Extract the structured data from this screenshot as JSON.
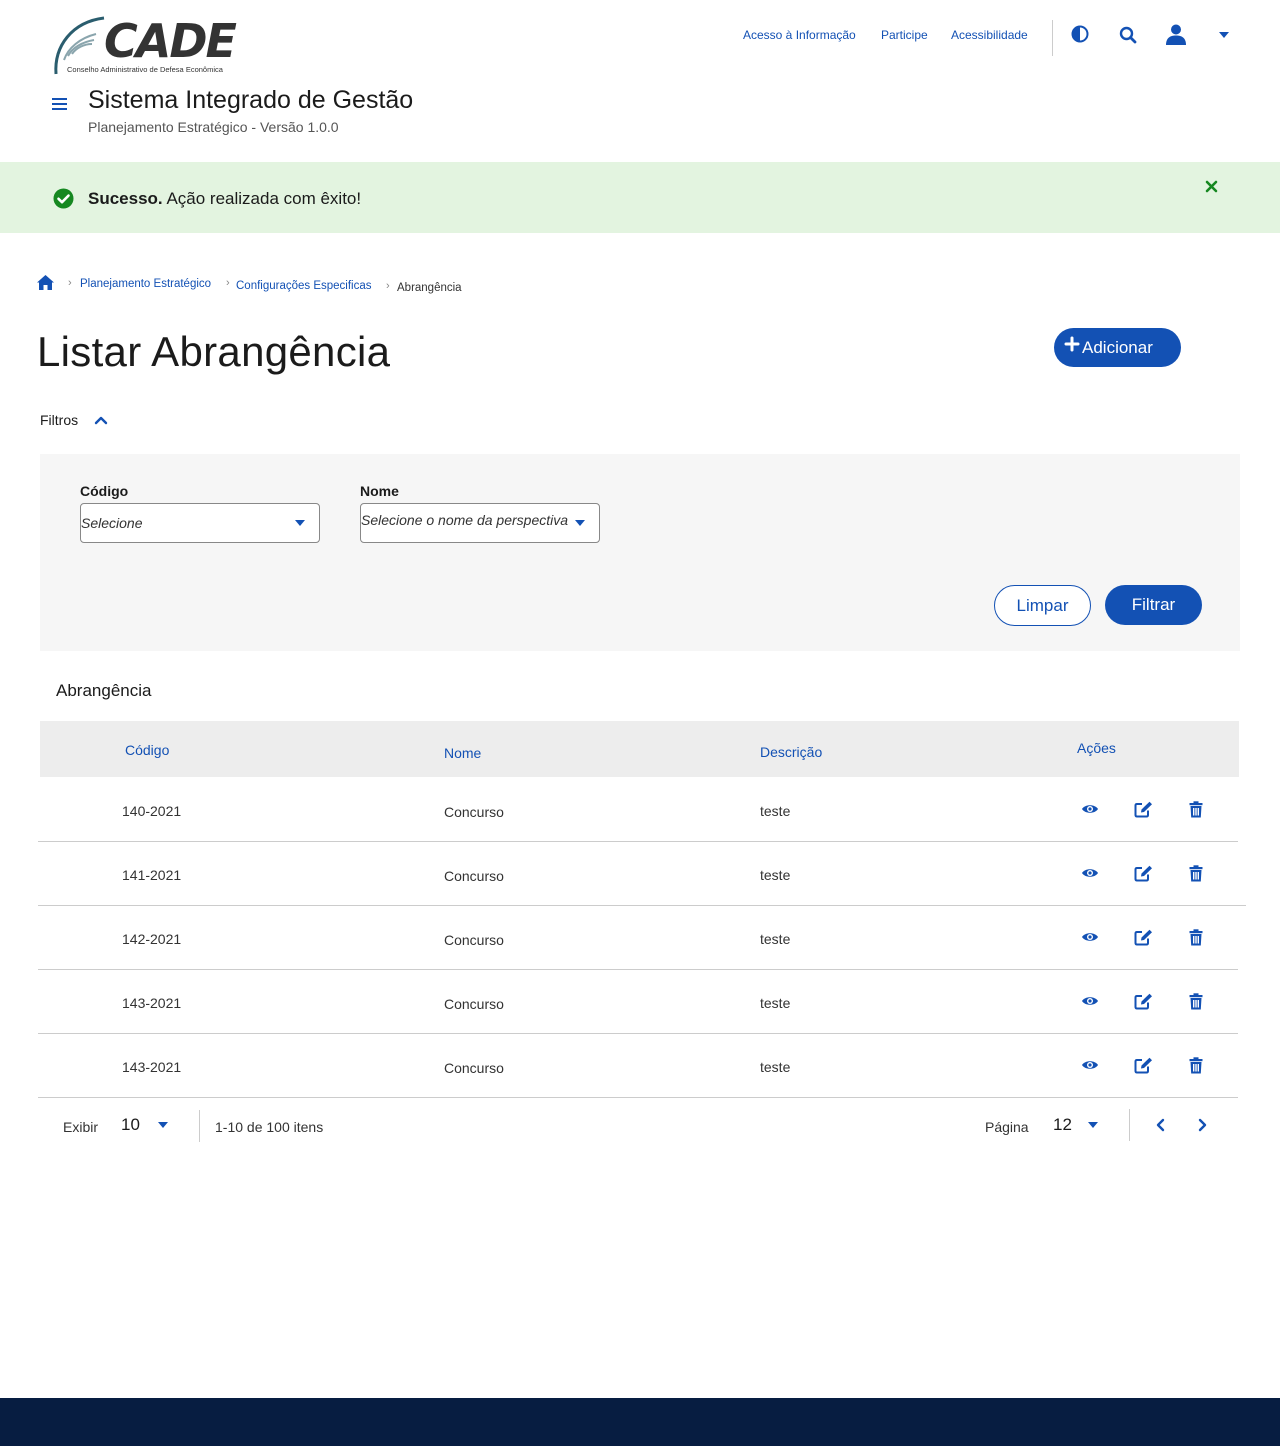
{
  "header": {
    "logo_text": "CADE",
    "logo_subtitle": "Conselho Administrativo de Defesa Econômica",
    "links": [
      "Acesso à Informação",
      "Participe",
      "Acessibilidade"
    ],
    "app_title": "Sistema Integrado de Gestão",
    "app_subtitle": "Planejamento Estratégico - Versão 1.0.0"
  },
  "alert": {
    "strong": "Sucesso.",
    "message": " Ação realizada com êxito!"
  },
  "breadcrumb": [
    "Planejamento Estratégico",
    "Configurações Especificas",
    "Abrangência"
  ],
  "page": {
    "title": "Listar Abrangência",
    "add_button": "Adicionar"
  },
  "filters": {
    "toggle_label": "Filtros",
    "codigo_label": "Código",
    "codigo_value": "Selecione",
    "nome_label": "Nome",
    "nome_value": "Selecione o nome da perspectiva",
    "clear_button": "Limpar",
    "filter_button": "Filtrar"
  },
  "table": {
    "title": "Abrangência",
    "columns": [
      "Código",
      "Nome",
      "Descrição",
      "Ações"
    ],
    "rows": [
      {
        "codigo": "140-2021",
        "nome": "Concurso",
        "descricao": "teste"
      },
      {
        "codigo": "141-2021",
        "nome": "Concurso",
        "descricao": "teste"
      },
      {
        "codigo": "142-2021",
        "nome": "Concurso",
        "descricao": "teste"
      },
      {
        "codigo": "143-2021",
        "nome": "Concurso",
        "descricao": "teste"
      },
      {
        "codigo": "143-2021",
        "nome": "Concurso",
        "descricao": "teste"
      }
    ]
  },
  "pagination": {
    "show_label": "Exibir",
    "page_size": "10",
    "range_text": "1-10 de 100 itens",
    "page_label": "Página",
    "page_number": "12"
  },
  "colors": {
    "primary": "#1351b4",
    "success_bg": "#e3f4e0",
    "success_icon": "#168821",
    "footer": "#071d41"
  }
}
